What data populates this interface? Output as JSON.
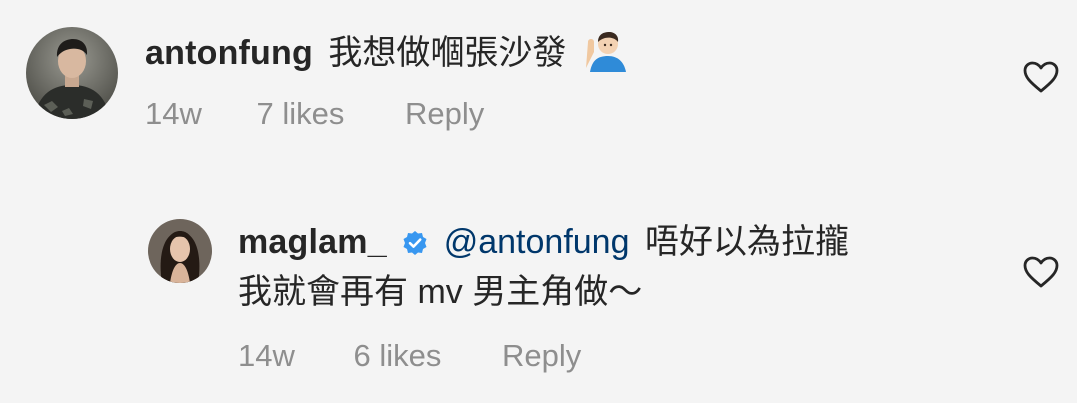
{
  "comments": [
    {
      "username": "antonfung",
      "text": "我想做嗰張沙發",
      "emoji_icon": "man-raising-hand-emoji-icon",
      "time": "14w",
      "likes": "7 likes",
      "reply": "Reply"
    },
    {
      "username": "maglam_",
      "verified_icon": "verified-badge-icon",
      "mention": "@antonfung",
      "text_line1": "唔好以為拉攏",
      "text_line2": "我就會再有 mv 男主角做～",
      "time": "14w",
      "likes": "6 likes",
      "reply": "Reply"
    }
  ],
  "colors": {
    "text": "#262626",
    "meta": "#8e8e8e",
    "verified": "#3897f0",
    "mention": "#00376b",
    "background": "#f4f4f4"
  }
}
